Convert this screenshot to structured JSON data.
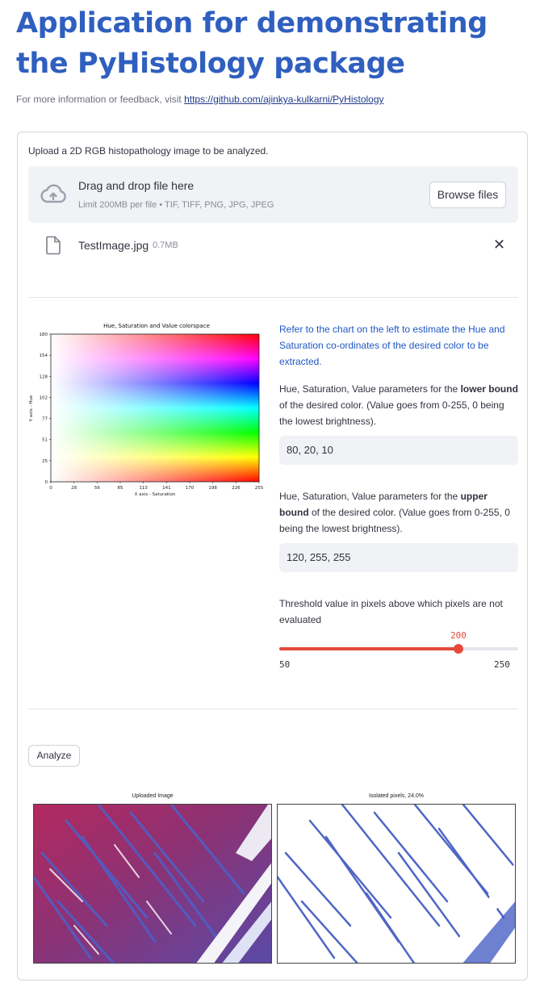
{
  "header": {
    "title": "Application for demonstrating the PyHistology package",
    "subtitle_prefix": "For more information or feedback, visit ",
    "link_text": "https://github.com/ajinkya-kulkarni/PyHistology"
  },
  "upload": {
    "label": "Upload a 2D RGB histopathology image to be analyzed.",
    "dropzone_title": "Drag and drop file here",
    "dropzone_limit": "Limit 200MB per file • TIF, TIFF, PNG, JPG, JPEG",
    "browse_label": "Browse files",
    "file_name": "TestImage.jpg",
    "file_size": "0.7MB"
  },
  "hsv_chart": {
    "title": "Hue, Saturation and Value colorspace",
    "xlabel": "X axis - Saturation",
    "ylabel": "Y axis - Hue",
    "xticks": [
      "0",
      "28",
      "56",
      "85",
      "113",
      "141",
      "170",
      "198",
      "226",
      "255"
    ],
    "yticks": [
      "0",
      "25",
      "51",
      "77",
      "102",
      "128",
      "154",
      "180"
    ]
  },
  "params": {
    "info": "Refer to the chart on the left to estimate the Hue and Saturation co-ordinates of the desired color to be extracted.",
    "lower_prefix": "Hue, Saturation, Value parameters for the ",
    "lower_bold": "lower bound",
    "lower_suffix": " of the desired color. (Value goes from 0-255, 0 being the lowest brightness).",
    "lower_value": "80, 20, 10",
    "upper_prefix": "Hue, Saturation, Value parameters for the ",
    "upper_bold": "upper bound",
    "upper_suffix": " of the desired color. (Value goes from 0-255, 0 being the lowest brightness).",
    "upper_value": "120, 255, 255",
    "threshold_label": "Threshold value in pixels above which pixels are not evaluated",
    "threshold_value": "200",
    "threshold_min": "50",
    "threshold_max": "250",
    "threshold_fraction": 0.75
  },
  "results": {
    "analyze_label": "Analyze",
    "uploaded_title": "Uploaded Image",
    "isolated_title": "Isolated pixels, 24.0%"
  },
  "colors": {
    "title": "#2f5fbf",
    "accent": "#e34a3c",
    "info": "#1f57c3",
    "stain_red": "#9b2f6b",
    "stain_blue": "#3d56c0"
  }
}
